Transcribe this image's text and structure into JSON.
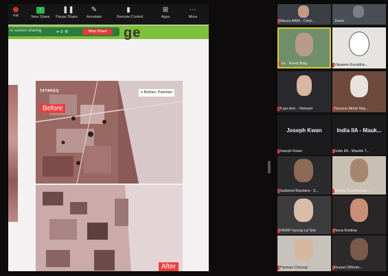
{
  "toolbar": {
    "items": [
      {
        "label": "",
        "icon": "participants-icon"
      },
      {
        "label": "New Share",
        "icon": "new-share-icon"
      },
      {
        "label": "Pause Share",
        "icon": "pause-icon"
      },
      {
        "label": "Annotate",
        "icon": "pencil-icon"
      },
      {
        "label": "Remote Control",
        "icon": "mouse-icon"
      },
      {
        "label": "Apps",
        "icon": "apps-icon"
      },
      {
        "label": "More",
        "icon": "more-icon"
      }
    ],
    "left_fragment": "hat"
  },
  "sharebar": {
    "status": "re screen sharing",
    "stop_label": "Stop Share"
  },
  "slide": {
    "title_fragment": "ge",
    "location_label": "Bojhan, Pakistan",
    "before_label": "Before",
    "after_label": "After",
    "brand": "TATWEEQ"
  },
  "gallery": {
    "tiles": [
      {
        "name": "Macau AAM - CHoi...",
        "kind": "video"
      },
      {
        "name": "Zoom",
        "kind": "video"
      },
      {
        "name": "LE - Raniz Baig",
        "kind": "video",
        "active": true
      },
      {
        "name": "Vipawee Kunatiha...",
        "kind": "video"
      },
      {
        "name": "Tuan Anh - Vietnam",
        "kind": "video"
      },
      {
        "name": "Norizna Mohd Nay...",
        "kind": "video"
      },
      {
        "name": "Joseph Kwan",
        "kind": "name",
        "big": "Joseph Kwan"
      },
      {
        "name": "India IIA - Maukik T...",
        "kind": "name",
        "big": "India IIA - Mauk..."
      },
      {
        "name": "Sadamal Bandara - S...",
        "kind": "video"
      },
      {
        "name": "Anatta Sreethachat...",
        "kind": "video"
      },
      {
        "name": "KIRAP Hyung Lyl Sim",
        "kind": "video"
      },
      {
        "name": "Nova Kristina",
        "kind": "video"
      },
      {
        "name": "Thomas Cheung",
        "kind": "video"
      },
      {
        "name": "Russel DBindo...",
        "kind": "video"
      }
    ]
  },
  "colors": {
    "accent_red": "#e8413f",
    "share_green": "#7fbf3a",
    "active_border": "#d6d02b"
  }
}
